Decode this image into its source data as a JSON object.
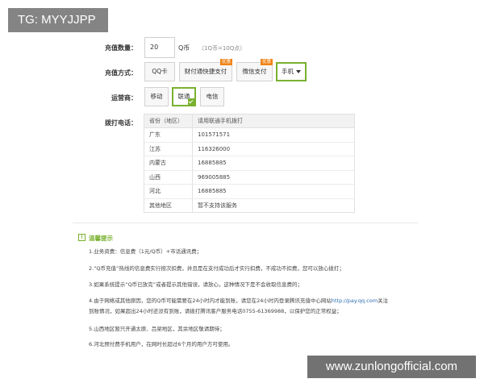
{
  "overlay_tag": "TG: MYYJJPP",
  "watermark": "www.zunlongofficial.com",
  "amount": {
    "label": "充值数量：",
    "value": "20",
    "unit": "Q币",
    "note": "（1Q币=10Q点）"
  },
  "method": {
    "label": "充值方式：",
    "options": [
      {
        "label": "QQ卡",
        "badge": ""
      },
      {
        "label": "财付通快捷支付",
        "badge": "优惠"
      },
      {
        "label": "微信支付",
        "badge": "优惠"
      },
      {
        "label": "手机",
        "badge": "",
        "selected": true
      }
    ]
  },
  "carrier": {
    "label": "运营商：",
    "options": [
      {
        "label": "移动"
      },
      {
        "label": "联通",
        "selected": true
      },
      {
        "label": "电信"
      }
    ]
  },
  "dial": {
    "label": "拨打电话：",
    "headers": [
      "省份（地区）",
      "请用联通手机拨打"
    ],
    "rows": [
      [
        "广东",
        "101571571"
      ],
      [
        "江苏",
        "116326000"
      ],
      [
        "内蒙古",
        "16885885"
      ],
      [
        "山西",
        "969005885"
      ],
      [
        "河北",
        "16885885"
      ],
      [
        "其他地区",
        "暂不支持该服务"
      ]
    ]
  },
  "tips": {
    "icon": "!",
    "title": "温馨提示",
    "items": [
      {
        "text": "1.业务资费：信息费（1元/Q币）+市话通讯费；"
      },
      {
        "text": "2.“Q币充值”热线的信息费实行按次扣费，并且是在支付成功后才实行扣费，不成功不扣费，您可以放心拨打；"
      },
      {
        "text": "3.如果系统提示“Q币已放完”或者提示其他错误，请放心，这种情况下是不会收取信息费的；"
      },
      {
        "text": "4.由于网络或其他原因，您的Q币可能需要在24小时内才能到账，请您在24小时内登录腾讯充值中心网站",
        "link": "http://pay.qq.com",
        "text_after": "关注"
      },
      {
        "text": "到账情况，如果超出24小时还没有到账，请拨打腾讯客户服务电话0755-61369988，以保护您的正常权益；"
      },
      {
        "text": "5.山西地区暂只开通太原、吕梁地区，其余地区敬请期待；"
      },
      {
        "text": "6.河北预付费手机用户，在网时长超过6个月的用户方可使用。"
      }
    ]
  }
}
